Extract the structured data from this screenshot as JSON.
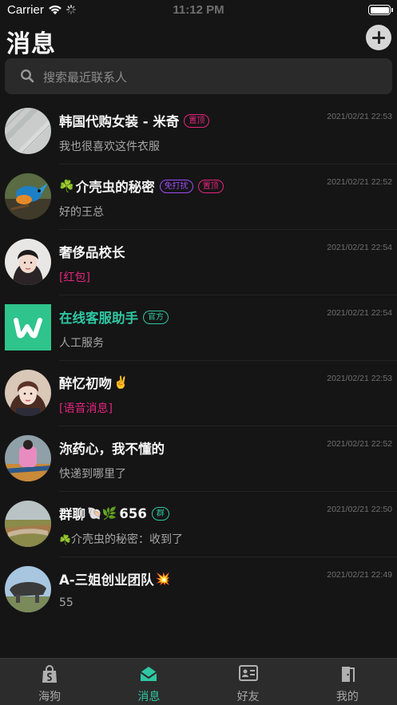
{
  "status_bar": {
    "carrier": "Carrier",
    "time": "11:12 PM"
  },
  "header": {
    "title": "消息",
    "add_icon": "plus-circle-icon"
  },
  "search": {
    "placeholder": "搜索最近联系人",
    "icon": "search-icon"
  },
  "conversations": [
    {
      "name": "韩国代购女装 - 米奇",
      "tags": [
        {
          "label": "置顶",
          "color": "#e6247f"
        }
      ],
      "preview": "我也很喜欢这件衣服",
      "time": "2021/02/21 22:53"
    },
    {
      "name": "介壳虫的秘密",
      "prefix_emoji": "☘️",
      "tags": [
        {
          "label": "免打扰",
          "color": "#a04bf5"
        },
        {
          "label": "置顶",
          "color": "#e6247f"
        }
      ],
      "preview": "好的王总",
      "time": "2021/02/21 22:52"
    },
    {
      "name": "奢侈品校长",
      "tags": [],
      "preview": "[红包]",
      "time": "2021/02/21 22:54"
    },
    {
      "name": "在线客服助手",
      "tags": [
        {
          "label": "官方",
          "color": "#2fc7a3"
        }
      ],
      "preview": "人工服务",
      "time": "2021/02/21 22:54"
    },
    {
      "name": "醉忆初吻",
      "suffix_emoji": "✌️",
      "tags": [],
      "preview": "[语音消息]",
      "time": "2021/02/21 22:53"
    },
    {
      "name": "沵药心，我不懂的",
      "tags": [],
      "preview": "快递到哪里了",
      "time": "2021/02/21 22:52"
    },
    {
      "name": "群聊",
      "name_emojis": "🐚🌿",
      "name_suffix": "656",
      "tags": [
        {
          "label": "群",
          "color": "#2fc7a3"
        }
      ],
      "preview_emoji": "☘️",
      "preview": "介壳虫的秘密：收到了",
      "time": "2021/02/21 22:50"
    },
    {
      "name": "A-三姐创业团队",
      "suffix_emoji": "💥",
      "tags": [],
      "preview": "55",
      "time": "2021/02/21 22:49"
    }
  ],
  "tabbar": {
    "active": "消息",
    "accent_color": "#2fc7a3",
    "items": [
      {
        "label": "海狗",
        "icon": "shopping-bag-icon"
      },
      {
        "label": "消息",
        "icon": "message-envelope-icon"
      },
      {
        "label": "好友",
        "icon": "contact-card-icon"
      },
      {
        "label": "我的",
        "icon": "door-icon"
      }
    ]
  }
}
